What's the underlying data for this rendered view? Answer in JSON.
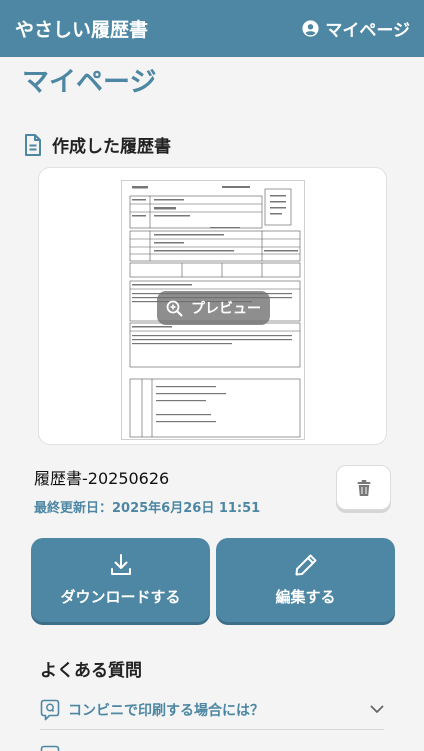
{
  "header": {
    "brand": "やさしい履歴書",
    "mypage_label": "マイページ"
  },
  "page": {
    "title": "マイページ"
  },
  "section": {
    "created_resumes": "作成した履歴書"
  },
  "preview": {
    "button_label": "プレビュー"
  },
  "resume": {
    "name": "履歴書-20250626",
    "updated": "最終更新日：2025年6月26日 11:51"
  },
  "actions": {
    "download": "ダウンロードする",
    "edit": "編集する"
  },
  "faq": {
    "title": "よくある質問",
    "items": [
      {
        "question": "コンビニで印刷する場合には？"
      }
    ]
  },
  "colors": {
    "primary": "#4d87a3"
  }
}
